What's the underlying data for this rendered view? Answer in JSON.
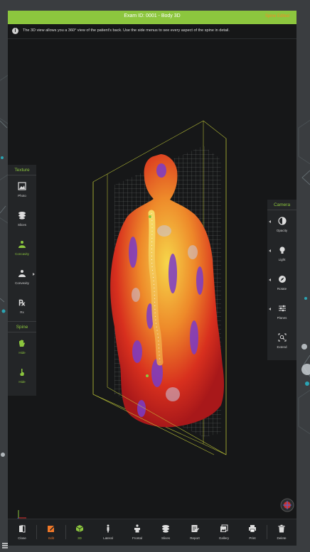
{
  "header": {
    "title": "Exam ID: 0001 - Body 3D",
    "status": "Spine Edited"
  },
  "info": {
    "text": "The 3D view allows you a 360° view of the patient's back. Use the side menus to see every aspect of the spine in detail."
  },
  "texture_menu": {
    "title": "Texture",
    "items": [
      {
        "label": "Photo",
        "icon": "photo-icon"
      },
      {
        "label": "Slices",
        "icon": "slices-icon"
      },
      {
        "label": "Concavity",
        "icon": "concavity-icon",
        "active": true
      },
      {
        "label": "Convexity",
        "icon": "convexity-icon"
      },
      {
        "label": "Rx",
        "icon": "rx-icon"
      }
    ]
  },
  "spine_menu": {
    "title": "Spine",
    "items": [
      {
        "label": "Hide",
        "icon": "hand-icon"
      },
      {
        "label": "Hide",
        "icon": "pointer-hand-icon"
      }
    ]
  },
  "camera_menu": {
    "title": "Camera",
    "items": [
      {
        "label": "Opacity",
        "icon": "contrast-icon"
      },
      {
        "label": "Light",
        "icon": "lightbulb-icon"
      },
      {
        "label": "Rotate",
        "icon": "compass-icon"
      },
      {
        "label": "Planes",
        "icon": "sliders-icon"
      },
      {
        "label": "Extend",
        "icon": "zoom-extend-icon"
      }
    ]
  },
  "toolbar": {
    "items": [
      {
        "label": "Close",
        "icon": "close-door-icon"
      },
      {
        "label": "Edit",
        "icon": "edit-icon"
      },
      {
        "label": "3D",
        "icon": "cube-icon"
      },
      {
        "label": "Lateral",
        "icon": "lateral-body-icon"
      },
      {
        "label": "Frontal",
        "icon": "frontal-body-icon"
      },
      {
        "label": "Slices",
        "icon": "slices-icon"
      },
      {
        "label": "Report",
        "icon": "report-icon"
      },
      {
        "label": "Gallery",
        "icon": "gallery-icon"
      },
      {
        "label": "Print",
        "icon": "print-icon"
      },
      {
        "label": "Delete",
        "icon": "trash-icon"
      }
    ]
  },
  "colors": {
    "accent_green": "#8cc63e",
    "accent_orange": "#f07828",
    "panel_bg": "#161718",
    "menu_bg": "#232527"
  }
}
